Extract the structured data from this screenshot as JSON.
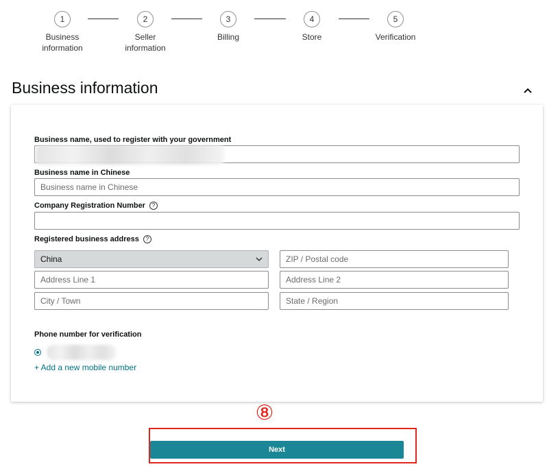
{
  "stepper": {
    "steps": [
      {
        "number": "1",
        "label_line1": "Business",
        "label_line2": "information"
      },
      {
        "number": "2",
        "label_line1": "Seller",
        "label_line2": "information"
      },
      {
        "number": "3",
        "label_line1": "Billing",
        "label_line2": ""
      },
      {
        "number": "4",
        "label_line1": "Store",
        "label_line2": ""
      },
      {
        "number": "5",
        "label_line1": "Verification",
        "label_line2": ""
      }
    ]
  },
  "section": {
    "title": "Business information",
    "collapse_icon": "chevron-up-icon"
  },
  "form": {
    "business_name_label": "Business name, used to register with your government",
    "business_name_chinese_label": "Business name in Chinese",
    "business_name_chinese_placeholder": "Business name in Chinese",
    "company_reg_label": "Company Registration Number",
    "help_icon_glyph": "?",
    "registered_address_label": "Registered business address",
    "country_selected": "China",
    "zip_placeholder": "ZIP / Postal code",
    "address1_placeholder": "Address Line 1",
    "address2_placeholder": "Address Line 2",
    "city_placeholder": "City / Town",
    "state_placeholder": "State / Region",
    "phone_label": "Phone number for verification",
    "add_mobile_link": "+ Add a new mobile number"
  },
  "annotation": {
    "number": "⑧",
    "color": "#e1251b"
  },
  "footer": {
    "next_label": "Next",
    "next_color": "#1b8796"
  }
}
